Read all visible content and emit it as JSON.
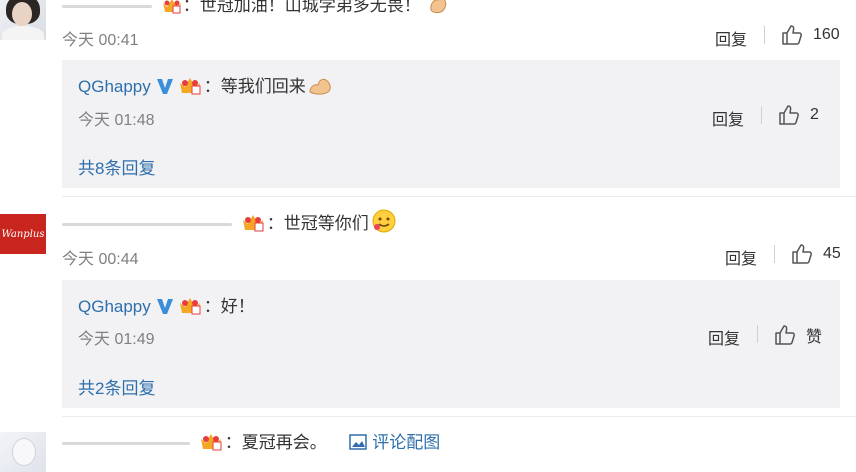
{
  "comments": [
    {
      "text": "：世冠加油！山城学弟多无畏！",
      "time": "今天 00:41",
      "reply_label": "回复",
      "likes": "160",
      "replies": [
        {
          "user": "QGhappy",
          "text": "：等我们回来",
          "time": "今天 01:48",
          "reply_label": "回复",
          "likes": "2"
        }
      ],
      "more_replies": "共8条回复"
    },
    {
      "text": "：世冠等你们",
      "time": "今天 00:44",
      "reply_label": "回复",
      "likes": "45",
      "avatar_text": "Wanplus",
      "replies": [
        {
          "user": "QGhappy",
          "text": "：好！",
          "time": "今天 01:49",
          "reply_label": "回复",
          "likes": "赞"
        }
      ],
      "more_replies": "共2条回复"
    },
    {
      "text": "：夏冠再会。",
      "attachment": "评论配图"
    }
  ],
  "colors": {
    "link": "#2e6fab",
    "reply_bg": "#f2f2f5",
    "meta": "#808080"
  },
  "icons": [
    "thumbs-up-icon",
    "verified-v-icon",
    "crown-badge-icon",
    "image-icon",
    "muscle-emoji-icon",
    "smile-emoji-icon"
  ]
}
